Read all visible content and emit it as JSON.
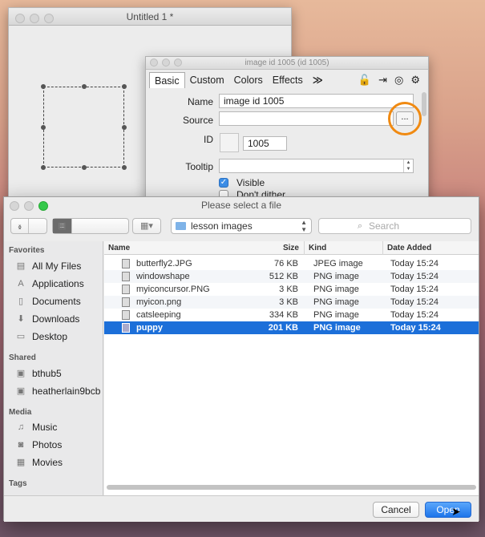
{
  "untitled_window": {
    "title": "Untitled 1 *"
  },
  "inspector": {
    "title": "image id 1005 (id 1005)",
    "tabs": [
      {
        "label": "Basic"
      },
      {
        "label": "Custom"
      },
      {
        "label": "Colors"
      },
      {
        "label": "Effects"
      }
    ],
    "more_tabs_glyph": "≫",
    "fields": {
      "name_label": "Name",
      "name_value": "image id 1005",
      "source_label": "Source",
      "source_value": "",
      "browse_label": "...",
      "id_label": "ID",
      "id_value": "1005",
      "tooltip_label": "Tooltip",
      "tooltip_value": ""
    },
    "checkboxes": [
      {
        "label": "Visible",
        "checked": true
      },
      {
        "label": "Don't dither",
        "checked": false
      }
    ],
    "icons": [
      "lock-icon",
      "export-icon",
      "target-icon",
      "gear-icon"
    ],
    "highlight_color": "#f08a12"
  },
  "dialog": {
    "title": "Please select a file",
    "location": "lesson images",
    "search_placeholder": "Search",
    "sidebar": {
      "sections": [
        {
          "heading": "Favorites",
          "items": [
            {
              "label": "All My Files",
              "icon": "all-files-icon"
            },
            {
              "label": "Applications",
              "icon": "applications-icon"
            },
            {
              "label": "Documents",
              "icon": "documents-icon"
            },
            {
              "label": "Downloads",
              "icon": "downloads-icon"
            },
            {
              "label": "Desktop",
              "icon": "desktop-icon"
            }
          ]
        },
        {
          "heading": "Shared",
          "items": [
            {
              "label": "bthub5",
              "icon": "computer-icon"
            },
            {
              "label": "heatherlain9bcb",
              "icon": "computer-icon"
            }
          ]
        },
        {
          "heading": "Media",
          "items": [
            {
              "label": "Music",
              "icon": "music-icon"
            },
            {
              "label": "Photos",
              "icon": "camera-icon"
            },
            {
              "label": "Movies",
              "icon": "film-icon"
            }
          ]
        },
        {
          "heading": "Tags",
          "items": []
        }
      ]
    },
    "columns": {
      "name": "Name",
      "size": "Size",
      "kind": "Kind",
      "date": "Date Added"
    },
    "files": [
      {
        "name": "butterfly2.JPG",
        "size": "76 KB",
        "kind": "JPEG image",
        "date": "Today 15:24",
        "selected": false
      },
      {
        "name": "windowshape",
        "size": "512 KB",
        "kind": "PNG image",
        "date": "Today 15:24",
        "selected": false
      },
      {
        "name": "myiconcursor.PNG",
        "size": "3 KB",
        "kind": "PNG image",
        "date": "Today 15:24",
        "selected": false
      },
      {
        "name": "myicon.png",
        "size": "3 KB",
        "kind": "PNG image",
        "date": "Today 15:24",
        "selected": false
      },
      {
        "name": "catsleeping",
        "size": "334 KB",
        "kind": "PNG image",
        "date": "Today 15:24",
        "selected": false
      },
      {
        "name": "puppy",
        "size": "201 KB",
        "kind": "PNG image",
        "date": "Today 15:24",
        "selected": true
      }
    ],
    "buttons": {
      "cancel": "Cancel",
      "open": "Open"
    },
    "view_glyphs": {
      "back": "‹",
      "forward": "›",
      "icon": "▦",
      "list": "≡",
      "columns": "▥",
      "coverflow": "▤",
      "arrange": "▦▾"
    }
  }
}
